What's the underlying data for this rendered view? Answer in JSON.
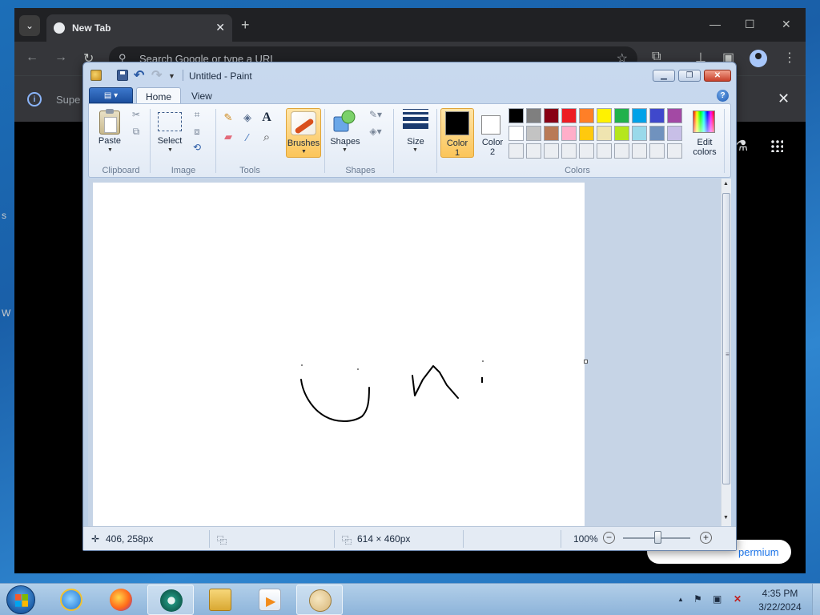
{
  "chrome": {
    "tab_title": "New Tab",
    "tab_close": "✕",
    "new_tab": "+",
    "minimize": "—",
    "maximize": "☐",
    "close": "✕",
    "back": "←",
    "forward": "→",
    "reload": "↻",
    "search_placeholder": "Search Google or type a URL",
    "infobar_text": "Supe",
    "infobar_close": "✕",
    "premium_label": "permium",
    "edge_letter_1": "s",
    "edge_letter_2": "W"
  },
  "paint": {
    "title": "Untitled - Paint",
    "tabs": {
      "home": "Home",
      "view": "View"
    },
    "help": "?",
    "groups": {
      "clipboard": "Clipboard",
      "image": "Image",
      "tools": "Tools",
      "shapes": "Shapes",
      "colors": "Colors"
    },
    "buttons": {
      "paste": "Paste",
      "select": "Select",
      "brushes": "Brushes",
      "shapes": "Shapes",
      "size": "Size",
      "color1_line1": "Color",
      "color1_line2": "1",
      "color2_line1": "Color",
      "color2_line2": "2",
      "edit_colors_line1": "Edit",
      "edit_colors_line2": "colors"
    },
    "tool_glyphs": {
      "pencil": "✎",
      "fill": "◈",
      "text": "A",
      "eraser": "▰",
      "picker": "⁄",
      "magnifier": "⌕"
    },
    "color1": "#000000",
    "color2": "#ffffff",
    "palette": [
      [
        "#000000",
        "#7f7f7f",
        "#880015",
        "#ed1c24",
        "#ff7f27",
        "#fff200",
        "#22b14c",
        "#00a2e8",
        "#3f48cc",
        "#a349a4"
      ],
      [
        "#ffffff",
        "#c3c3c3",
        "#b97a57",
        "#ffaec9",
        "#ffc90e",
        "#efe4b0",
        "#b5e61d",
        "#99d9ea",
        "#7092be",
        "#c8bfe7"
      ],
      [
        "#ebeef2",
        "#ebeef2",
        "#ebeef2",
        "#ebeef2",
        "#ebeef2",
        "#ebeef2",
        "#ebeef2",
        "#ebeef2",
        "#ebeef2",
        "#ebeef2"
      ]
    ],
    "status": {
      "cursor_pos": "406, 258px",
      "image_size": "614 × 460px",
      "zoom": "100%",
      "zoom_out": "−",
      "zoom_in": "+"
    },
    "scroll_up": "▲",
    "scroll_down": "▼"
  },
  "taskbar": {
    "time": "4:35 PM",
    "date": "3/22/2024",
    "tray_arrow": "▲",
    "tray_flag": "⚑",
    "tray_network": "▣",
    "tray_volume": "✕"
  }
}
